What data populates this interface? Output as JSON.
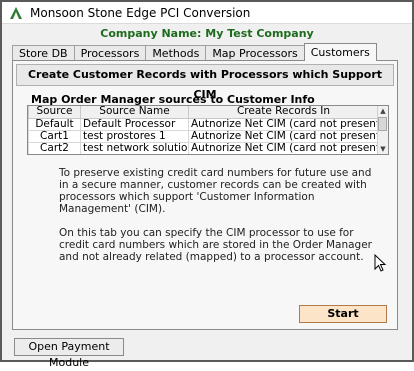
{
  "window": {
    "title": "Monsoon Stone Edge PCI Conversion"
  },
  "company": {
    "label": "Company Name: My Test Company"
  },
  "tabs": [
    {
      "label": "Store DB",
      "active": false
    },
    {
      "label": "Processors",
      "active": false
    },
    {
      "label": "Methods",
      "active": false
    },
    {
      "label": "Map Processors",
      "active": false
    },
    {
      "label": "Customers",
      "active": true
    }
  ],
  "panel": {
    "banner": "Create Customer Records with Processors which Support CIM",
    "section_title": "Map Order Manager sources to Customer Info Management (CIM) Processors",
    "columns": [
      "Source",
      "Source Name",
      "Create Records In"
    ],
    "rows": [
      {
        "source": "Default",
        "name": "Default Processor",
        "dest": "Autnorize Net CIM (card not present)"
      },
      {
        "source": "Cart1",
        "name": "test prostores 1",
        "dest": "Autnorize Net CIM (card not present)"
      },
      {
        "source": "Cart2",
        "name": "test network solutions",
        "dest": "Autnorize Net CIM (card not present)"
      }
    ],
    "info_1": "To preserve existing credit card numbers for future use and in a secure manner, customer records can be created with processors which support 'Customer Information Management' (CIM).",
    "info_2": "On this tab you can specify the CIM processor to use for credit card numbers which are stored in the Order Manager and not already related (mapped) to a processor account.",
    "start_label": "Start"
  },
  "footer": {
    "open_payment_label": "Open Payment Module"
  },
  "icons": {
    "app": "monsoon-logo-icon",
    "cursor": "mouse-pointer-icon"
  },
  "colors": {
    "company": "#1d6b1d",
    "start_bg": "#fce4c9"
  }
}
